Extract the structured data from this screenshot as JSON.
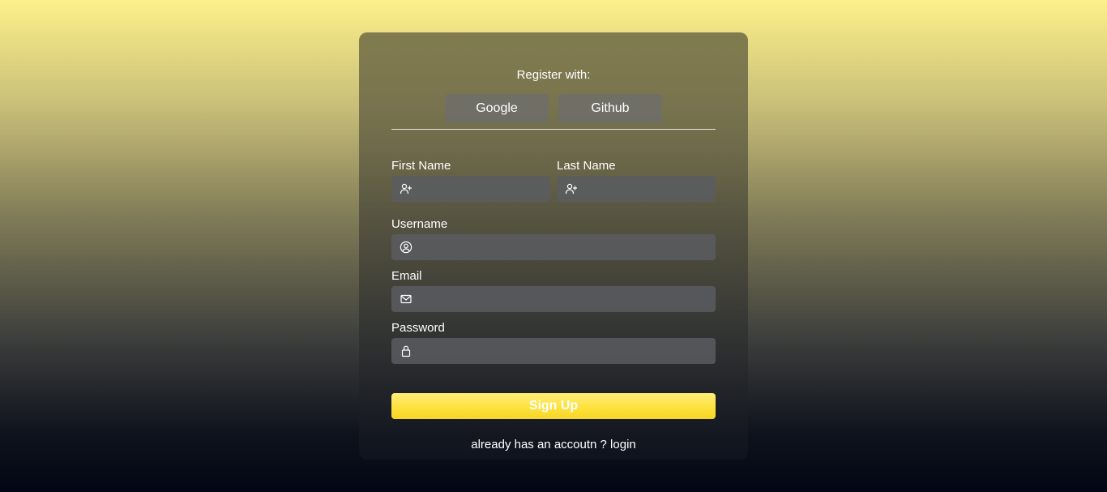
{
  "register": {
    "label": "Register with:",
    "google_label": "Google",
    "github_label": "Github"
  },
  "form": {
    "first_name": {
      "label": "First Name",
      "icon": "user-plus-icon",
      "value": ""
    },
    "last_name": {
      "label": "Last Name",
      "icon": "user-plus-icon",
      "value": ""
    },
    "username": {
      "label": "Username",
      "icon": "user-circle-icon",
      "value": ""
    },
    "email": {
      "label": "Email",
      "icon": "mail-icon",
      "value": ""
    },
    "password": {
      "label": "Password",
      "icon": "lock-icon",
      "value": ""
    }
  },
  "signup_label": "Sign Up",
  "footer": {
    "prefix": "already has an accoutn ? ",
    "login_label": "login"
  },
  "colors": {
    "accent": "#fde13a",
    "input_bg": "#5a5c60",
    "text": "#ffffff"
  }
}
